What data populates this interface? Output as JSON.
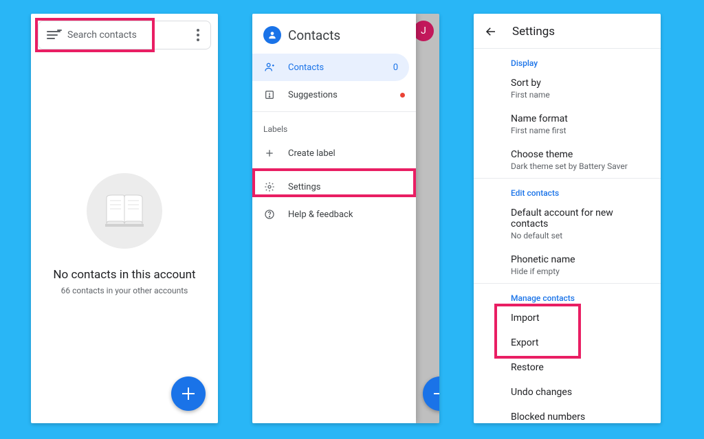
{
  "screen1": {
    "search_placeholder": "Search contacts",
    "empty_title": "No contacts in this account",
    "empty_subtitle": "66 contacts in your other accounts"
  },
  "screen2": {
    "title": "Contacts",
    "avatar_letter": "J",
    "items": {
      "contacts": "Contacts",
      "contacts_count": "0",
      "suggestions": "Suggestions",
      "labels_header": "Labels",
      "create_label": "Create label",
      "settings": "Settings",
      "help": "Help & feedback"
    }
  },
  "screen3": {
    "title": "Settings",
    "display_section": "Display",
    "sort_by": "Sort by",
    "sort_by_val": "First name",
    "name_format": "Name format",
    "name_format_val": "First name first",
    "theme": "Choose theme",
    "theme_val": "Dark theme set by Battery Saver",
    "edit_section": "Edit contacts",
    "default_account": "Default account for new contacts",
    "default_account_val": "No default set",
    "phonetic": "Phonetic name",
    "phonetic_val": "Hide if empty",
    "manage_section": "Manage contacts",
    "import": "Import",
    "export": "Export",
    "restore": "Restore",
    "undo": "Undo changes",
    "blocked": "Blocked numbers"
  }
}
